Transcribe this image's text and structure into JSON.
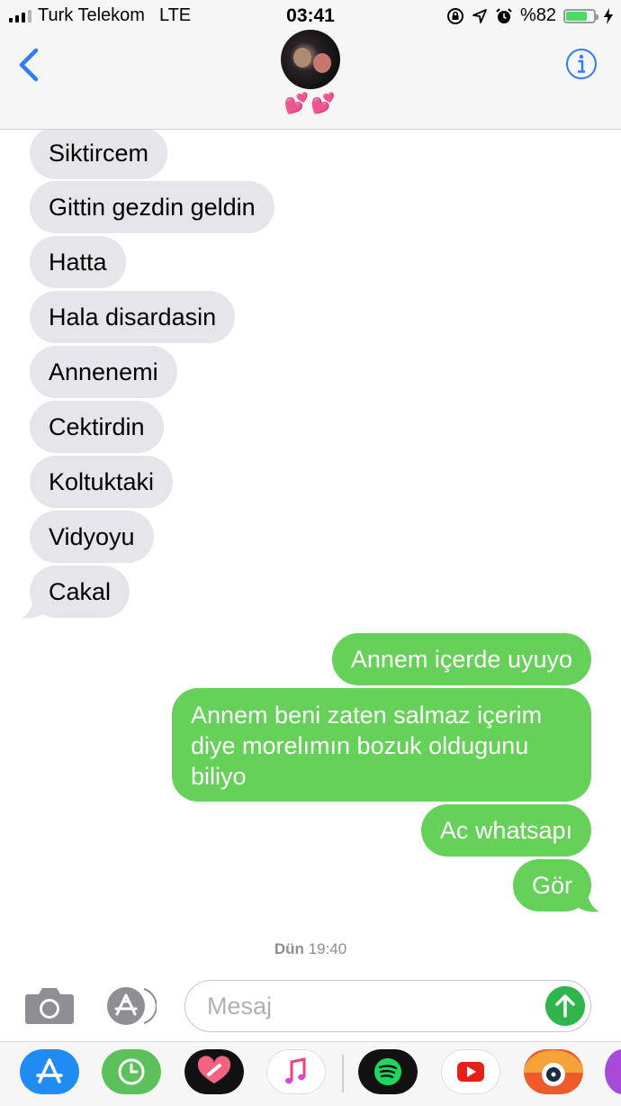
{
  "status_bar": {
    "carrier": "Turk Telekom",
    "network": "LTE",
    "time": "03:41",
    "battery_text": "%82",
    "battery_level": 0.82,
    "icons": [
      "signal-bars-icon",
      "orientation-lock-icon",
      "location-arrow-icon",
      "alarm-clock-icon",
      "battery-icon",
      "charging-bolt-icon"
    ]
  },
  "header": {
    "contact_name": "💕💕",
    "back_icon": "chevron-left-icon",
    "info_icon": "info-icon",
    "accent_color": "#2f7cf6"
  },
  "messages": [
    {
      "direction": "incoming",
      "text": "Siktircem"
    },
    {
      "direction": "incoming",
      "text": "Gittin gezdin geldin"
    },
    {
      "direction": "incoming",
      "text": "Hatta"
    },
    {
      "direction": "incoming",
      "text": "Hala disardasin"
    },
    {
      "direction": "incoming",
      "text": "Annenemi"
    },
    {
      "direction": "incoming",
      "text": "Cektirdin"
    },
    {
      "direction": "incoming",
      "text": "Koltuktaki"
    },
    {
      "direction": "incoming",
      "text": "Vidyoyu"
    },
    {
      "direction": "incoming",
      "text": "Cakal"
    },
    {
      "direction": "outgoing",
      "text": "Annem içerde uyuyo"
    },
    {
      "direction": "outgoing",
      "text": "Annem beni zaten salmaz  içerim diye morelımın bozuk oldugunu biliyo"
    },
    {
      "direction": "outgoing",
      "text": "Ac whatsapı"
    },
    {
      "direction": "outgoing",
      "text": "Gör"
    }
  ],
  "timestamp": {
    "day": "Dün",
    "time": "19:40"
  },
  "input_bar": {
    "placeholder": "Mesaj",
    "camera_icon": "camera-icon",
    "apps_icon": "app-store-icon",
    "send_icon": "send-arrow-up-icon"
  },
  "app_drawer": [
    "app-store-icon",
    "screen-time-clock-icon",
    "digital-touch-heart-icon",
    "music-note-icon",
    "spotify-icon",
    "youtube-icon",
    "camera-lens-app-icon"
  ],
  "colors": {
    "incoming_bubble": "#e5e5ea",
    "outgoing_bubble": "#65d158",
    "send_button": "#2fb64a"
  }
}
